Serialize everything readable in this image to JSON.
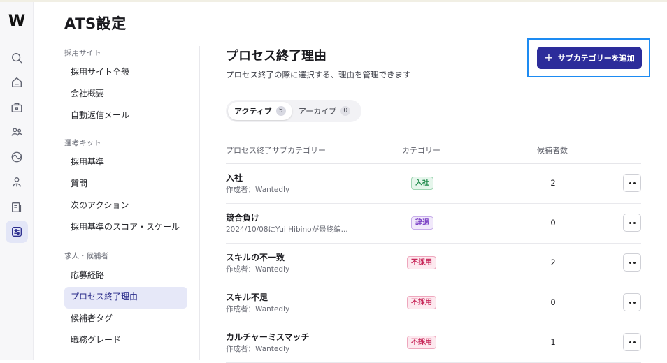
{
  "app": {
    "logo_text": "W"
  },
  "page_title": "ATS設定",
  "subnav": {
    "sections": [
      {
        "label": "採用サイト",
        "items": [
          "採用サイト全般",
          "会社概要",
          "自動返信メール"
        ]
      },
      {
        "label": "選考キット",
        "items": [
          "採用基準",
          "質問",
          "次のアクション",
          "採用基準のスコア・スケール"
        ]
      },
      {
        "label": "求人・候補者",
        "items": [
          "応募経路",
          "プロセス終了理由",
          "候補者タグ",
          "職務グレード"
        ]
      }
    ],
    "active_item": "プロセス終了理由"
  },
  "content": {
    "title": "プロセス終了理由",
    "description": "プロセス終了の際に選択する、理由を管理できます",
    "add_button_label": "サブカテゴリーを追加"
  },
  "tabs": [
    {
      "label": "アクティブ",
      "count": "5"
    },
    {
      "label": "アーカイブ",
      "count": "0"
    }
  ],
  "table": {
    "headers": {
      "name": "プロセス終了サブカテゴリー",
      "category": "カテゴリー",
      "candidates": "候補者数"
    },
    "rows": [
      {
        "name": "入社",
        "meta": "作成者：Wantedly",
        "category": "入社",
        "count": "2"
      },
      {
        "name": "競合負け",
        "meta": "2024/10/08にYui Hibinoが最終編...",
        "category": "辞退",
        "count": "0"
      },
      {
        "name": "スキルの不一致",
        "meta": "作成者：Wantedly",
        "category": "不採用",
        "count": "2"
      },
      {
        "name": "スキル不足",
        "meta": "作成者：Wantedly",
        "category": "不採用",
        "count": "0"
      },
      {
        "name": "カルチャーミスマッチ",
        "meta": "作成者：Wantedly",
        "category": "不採用",
        "count": "1"
      }
    ]
  },
  "colors": {
    "primary": "#2c2c9a",
    "highlight_border": "#1d8bf2",
    "badge_hired": "#1e8a4a",
    "badge_declined": "#7a3fc4",
    "badge_rejected": "#c8285a"
  },
  "rail_icons": [
    "search-icon",
    "home-icon",
    "briefcase-icon",
    "users-icon",
    "activity-icon",
    "person-icon",
    "document-icon",
    "settings-sliders-icon"
  ]
}
